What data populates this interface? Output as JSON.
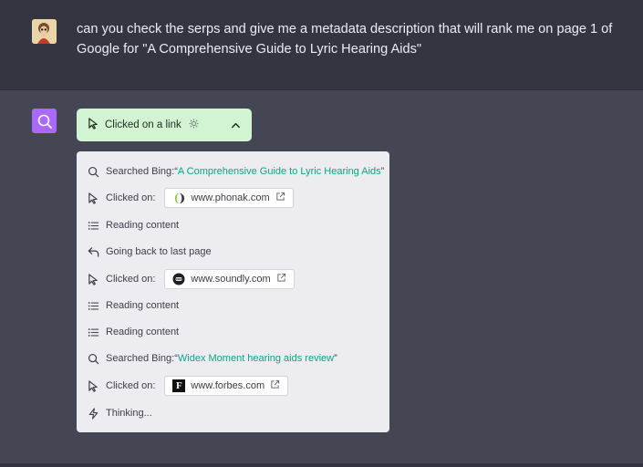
{
  "user_message": {
    "text": "can you check the serps and give me a metadata description that will rank me on page 1 of Google for \"A Comprehensive Guide to Lyric Hearing Aids\""
  },
  "status": {
    "label": "Clicked on a link",
    "spinner_icon": "gear-spinner-icon",
    "chevron_icon": "chevron-up-icon",
    "background": "#d2f4d3"
  },
  "steps": [
    {
      "icon": "search-icon",
      "label": "Searched Bing: ",
      "query_open": "“",
      "query": "A Comprehensive Guide to Lyric Hearing Aids",
      "query_close": "”"
    },
    {
      "icon": "cursor-icon",
      "label": "Clicked on:",
      "site": "www.phonak.com",
      "favicon": "phonak-favicon"
    },
    {
      "icon": "list-icon",
      "label": "Reading content"
    },
    {
      "icon": "back-arrow-icon",
      "label": "Going back to last page"
    },
    {
      "icon": "cursor-icon",
      "label": "Clicked on:",
      "site": "www.soundly.com",
      "favicon": "soundly-favicon"
    },
    {
      "icon": "list-icon",
      "label": "Reading content"
    },
    {
      "icon": "list-icon",
      "label": "Reading content"
    },
    {
      "icon": "search-icon",
      "label": "Searched Bing: ",
      "query_open": "“",
      "query": "Widex Moment hearing aids review",
      "query_close": "”"
    },
    {
      "icon": "cursor-icon",
      "label": "Clicked on:",
      "site": "www.forbes.com",
      "favicon": "forbes-favicon"
    },
    {
      "icon": "bolt-icon",
      "label": "Thinking..."
    }
  ],
  "colors": {
    "page_bg": "#444654",
    "user_bg": "#343541",
    "assistant_avatar": "#ab68ff",
    "query_link": "#10a37f",
    "panel_bg": "#ececf1"
  },
  "forbes_letter": "F"
}
